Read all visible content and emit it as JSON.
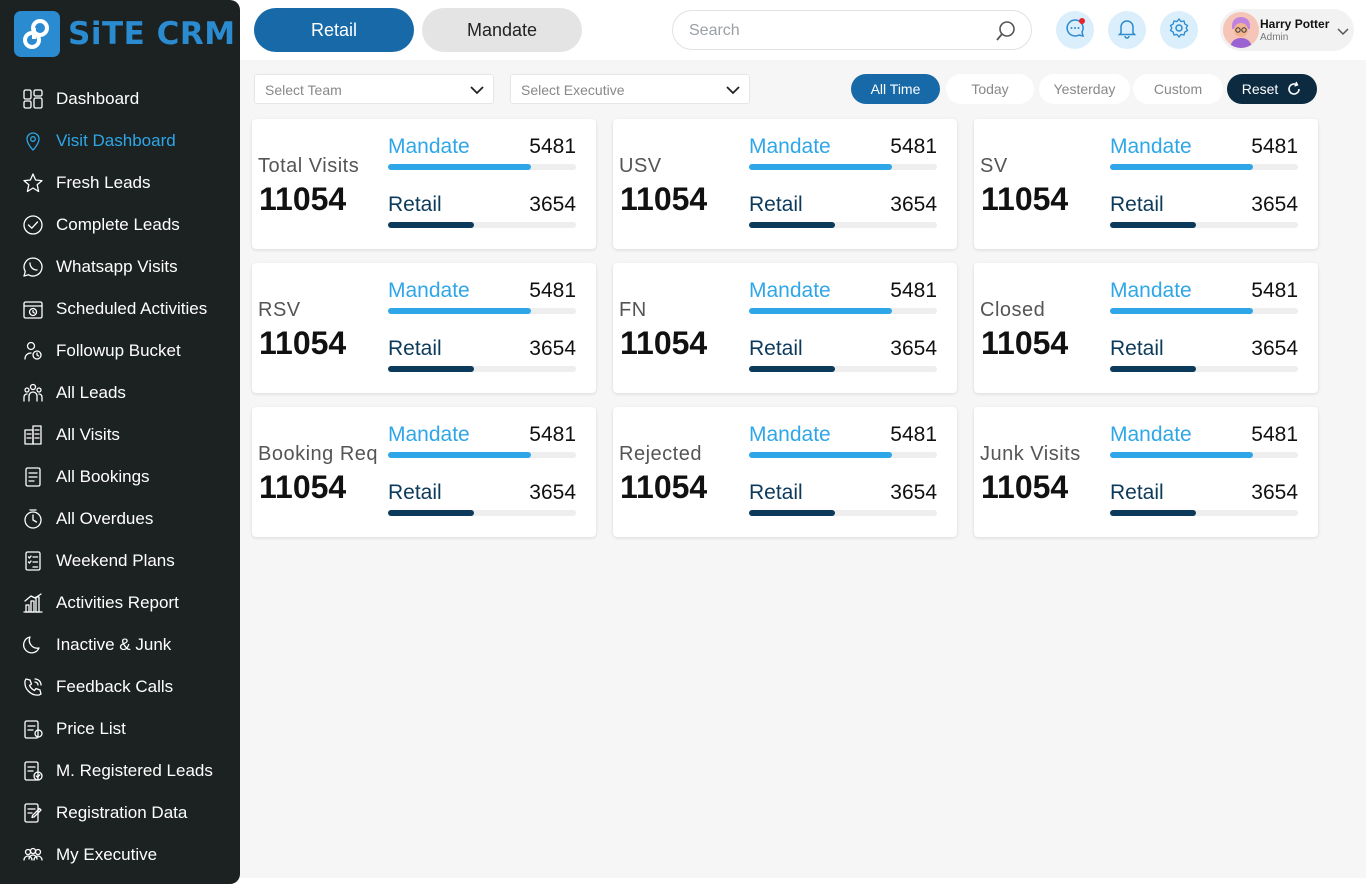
{
  "brand": {
    "name": "SiTE CRM",
    "color": "#2a8bd0"
  },
  "sidebar": {
    "items": [
      {
        "label": "Dashboard",
        "icon": "dashboard-grid-icon",
        "active": false
      },
      {
        "label": "Visit Dashboard",
        "icon": "location-pin-icon",
        "active": true
      },
      {
        "label": "Fresh Leads",
        "icon": "star-icon",
        "active": false
      },
      {
        "label": "Complete Leads",
        "icon": "check-circle-icon",
        "active": false
      },
      {
        "label": "Whatsapp Visits",
        "icon": "whatsapp-icon",
        "active": false
      },
      {
        "label": "Scheduled Activities",
        "icon": "calendar-clock-icon",
        "active": false
      },
      {
        "label": "Followup Bucket",
        "icon": "followup-person-icon",
        "active": false
      },
      {
        "label": "All Leads",
        "icon": "people-group-icon",
        "active": false
      },
      {
        "label": "All Visits",
        "icon": "building-icon",
        "active": false
      },
      {
        "label": "All Bookings",
        "icon": "booking-book-icon",
        "active": false
      },
      {
        "label": "All Overdues",
        "icon": "overdue-clock-icon",
        "active": false
      },
      {
        "label": "Weekend Plans",
        "icon": "checklist-icon",
        "active": false
      },
      {
        "label": "Activities Report",
        "icon": "bar-chart-icon",
        "active": false
      },
      {
        "label": "Inactive & Junk",
        "icon": "moon-icon",
        "active": false
      },
      {
        "label": "Feedback Calls",
        "icon": "phone-icon",
        "active": false
      },
      {
        "label": "Price List",
        "icon": "price-list-icon",
        "active": false
      },
      {
        "label": "M. Registered Leads",
        "icon": "registered-doc-icon",
        "active": false
      },
      {
        "label": "Registration Data",
        "icon": "edit-doc-icon",
        "active": false
      },
      {
        "label": "My Executive",
        "icon": "team-icon",
        "active": false
      }
    ]
  },
  "header": {
    "tabs": {
      "retail": "Retail",
      "mandate": "Mandate"
    },
    "search_placeholder": "Search",
    "user": {
      "name": "Harry Potter",
      "role": "Admin"
    }
  },
  "filters": {
    "team_placeholder": "Select Team",
    "executive_placeholder": "Select Executive",
    "time_ranges": [
      "All Time",
      "Today",
      "Yesterday",
      "Custom"
    ],
    "active_range": "All Time",
    "reset_label": "Reset"
  },
  "colors": {
    "accent": "#1769a8",
    "mandate": "#2fa6e8",
    "retail": "#0c3a5a",
    "sidebar_bg": "#1c2221"
  },
  "cards": [
    {
      "title": "Total Visits",
      "total": "11054",
      "mandate_label": "Mandate",
      "mandate_value": "5481",
      "mandate_ratio": 0.76,
      "retail_label": "Retail",
      "retail_value": "3654",
      "retail_ratio": 0.46
    },
    {
      "title": "USV",
      "total": "11054",
      "mandate_label": "Mandate",
      "mandate_value": "5481",
      "mandate_ratio": 0.76,
      "retail_label": "Retail",
      "retail_value": "3654",
      "retail_ratio": 0.46
    },
    {
      "title": "SV",
      "total": "11054",
      "mandate_label": "Mandate",
      "mandate_value": "5481",
      "mandate_ratio": 0.76,
      "retail_label": "Retail",
      "retail_value": "3654",
      "retail_ratio": 0.46
    },
    {
      "title": "RSV",
      "total": "11054",
      "mandate_label": "Mandate",
      "mandate_value": "5481",
      "mandate_ratio": 0.76,
      "retail_label": "Retail",
      "retail_value": "3654",
      "retail_ratio": 0.46
    },
    {
      "title": "FN",
      "total": "11054",
      "mandate_label": "Mandate",
      "mandate_value": "5481",
      "mandate_ratio": 0.76,
      "retail_label": "Retail",
      "retail_value": "3654",
      "retail_ratio": 0.46
    },
    {
      "title": "Closed",
      "total": "11054",
      "mandate_label": "Mandate",
      "mandate_value": "5481",
      "mandate_ratio": 0.76,
      "retail_label": "Retail",
      "retail_value": "3654",
      "retail_ratio": 0.46
    },
    {
      "title": "Booking Req",
      "total": "11054",
      "mandate_label": "Mandate",
      "mandate_value": "5481",
      "mandate_ratio": 0.76,
      "retail_label": "Retail",
      "retail_value": "3654",
      "retail_ratio": 0.46
    },
    {
      "title": "Rejected",
      "total": "11054",
      "mandate_label": "Mandate",
      "mandate_value": "5481",
      "mandate_ratio": 0.76,
      "retail_label": "Retail",
      "retail_value": "3654",
      "retail_ratio": 0.46
    },
    {
      "title": "Junk Visits",
      "total": "11054",
      "mandate_label": "Mandate",
      "mandate_value": "5481",
      "mandate_ratio": 0.76,
      "retail_label": "Retail",
      "retail_value": "3654",
      "retail_ratio": 0.46
    }
  ]
}
